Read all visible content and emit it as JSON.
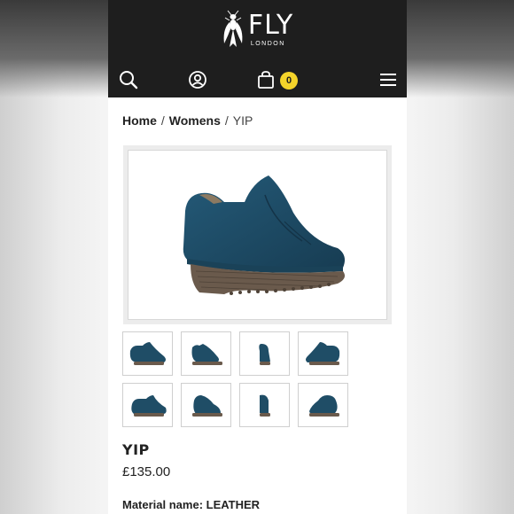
{
  "brand": {
    "logo_main": "FLY",
    "logo_sub": "LONDON"
  },
  "nav": {
    "icons": [
      "search-icon",
      "account-icon",
      "cart-icon",
      "menu-icon"
    ],
    "cart_count": "0",
    "badge_color": "#f5d42a"
  },
  "breadcrumb": {
    "home": "Home",
    "sep1": "/",
    "womens": "Womens",
    "sep2": "/",
    "current": "YIP"
  },
  "product": {
    "name": "YIP",
    "price": "£135.00",
    "material": "Material name: LEATHER",
    "color": "#1f4d66",
    "sole_color": "#6a5a4c"
  },
  "thumbnails": [
    {
      "view": "side-right"
    },
    {
      "view": "side-angle"
    },
    {
      "view": "front"
    },
    {
      "view": "side-left"
    },
    {
      "view": "side-right-2"
    },
    {
      "view": "three-quarter"
    },
    {
      "view": "back"
    },
    {
      "view": "side-left-2"
    }
  ]
}
